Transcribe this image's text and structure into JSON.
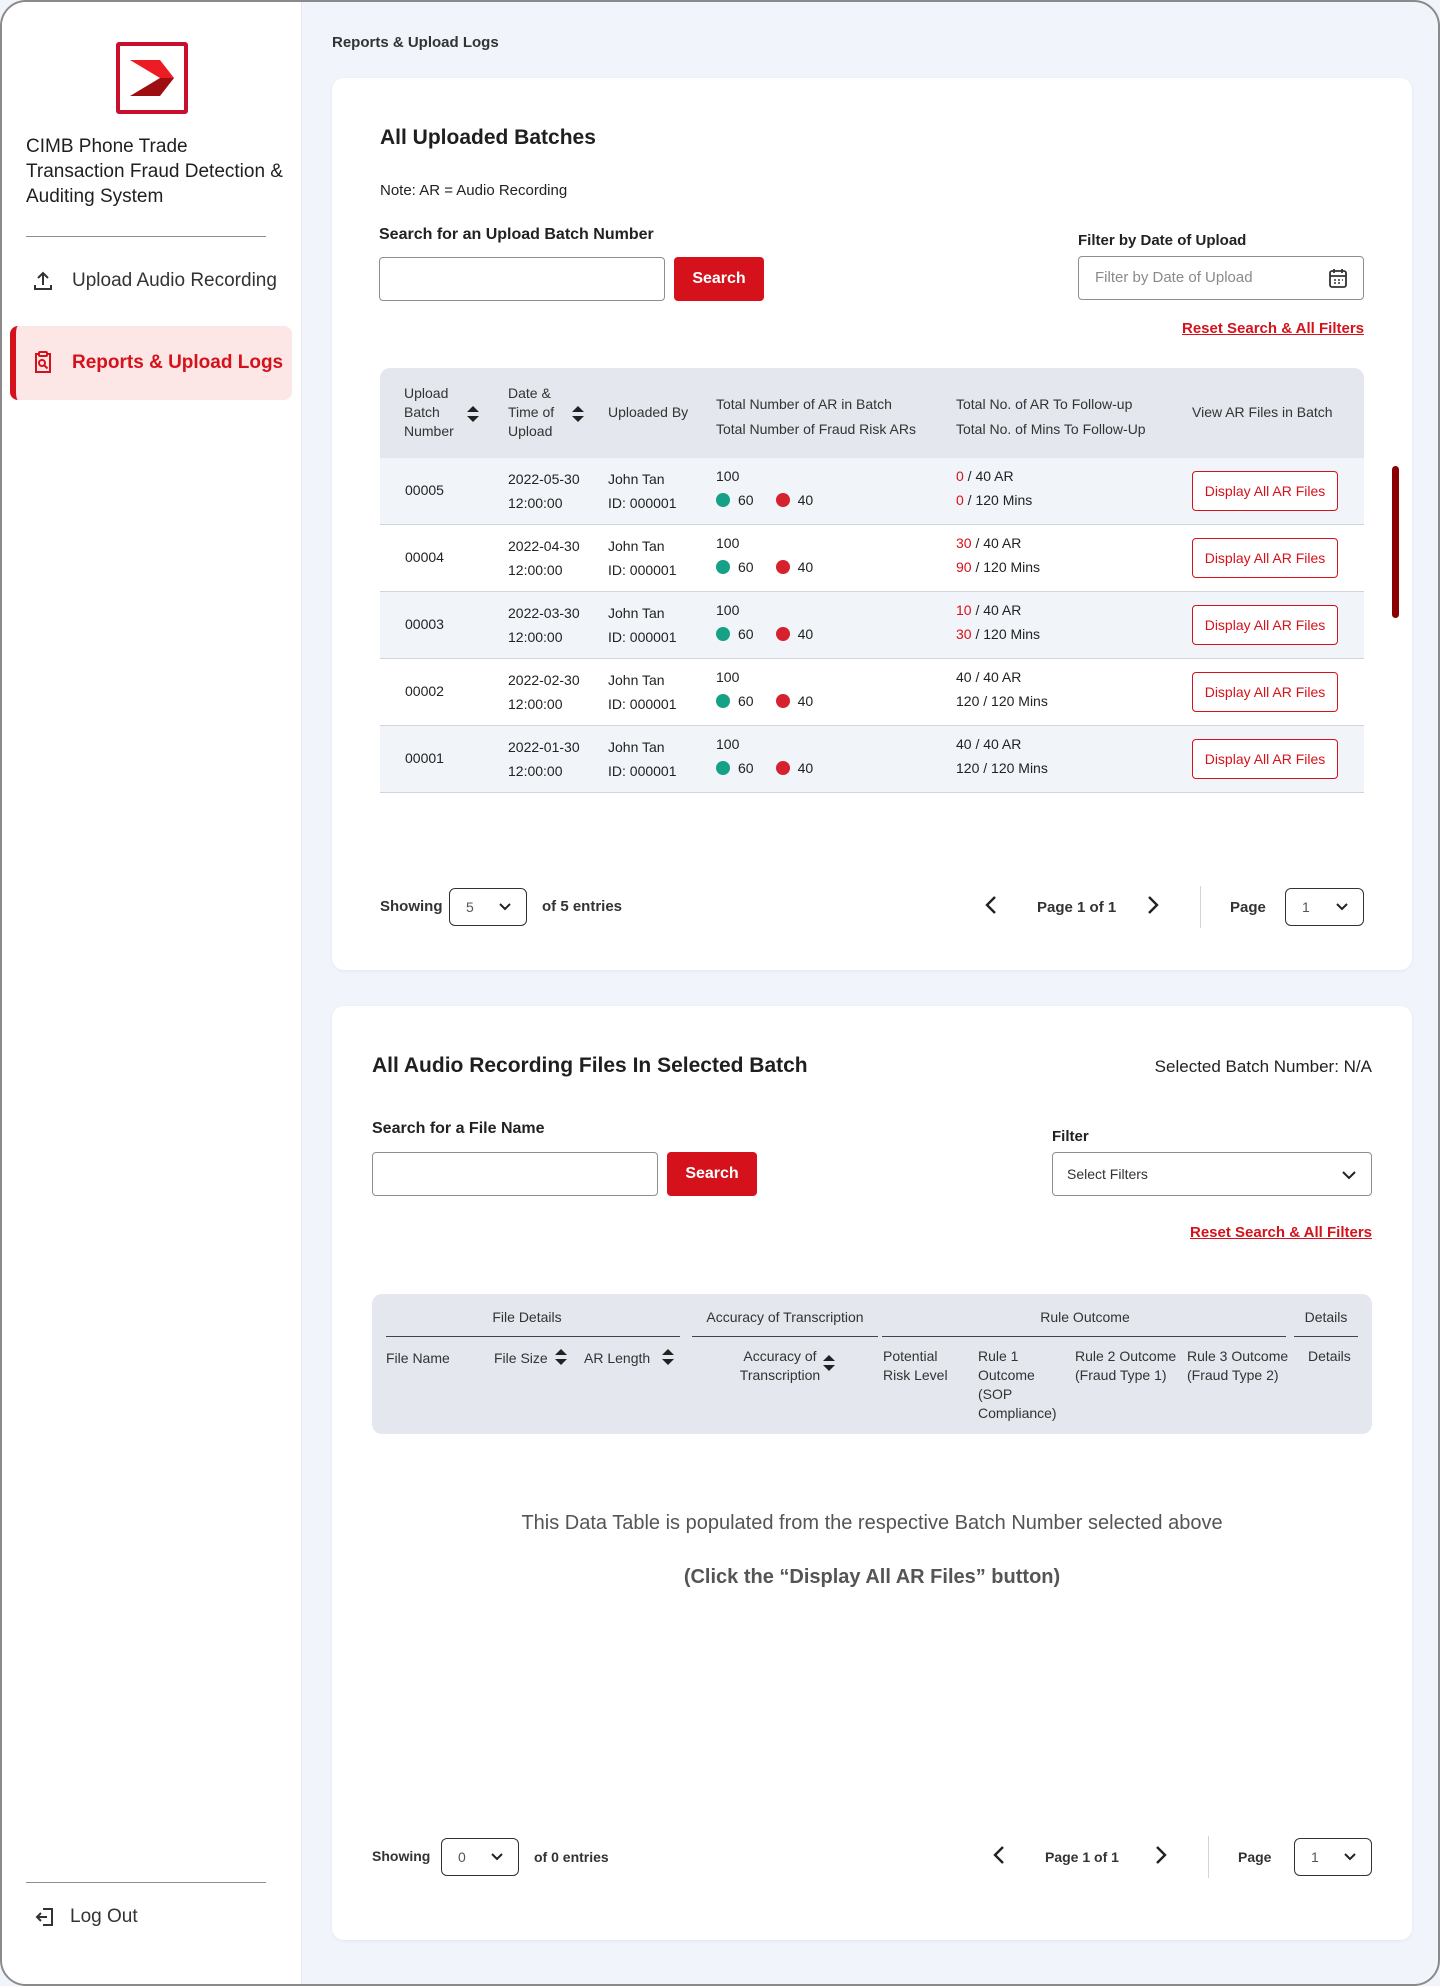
{
  "sidebar": {
    "app_title": "CIMB Phone Trade Transaction Fraud Detection & Auditing System",
    "nav": [
      {
        "label": "Upload Audio Recording",
        "icon": "upload-icon"
      },
      {
        "label": "Reports & Upload Logs",
        "icon": "report-search-icon",
        "active": true
      }
    ],
    "logout_label": "Log Out",
    "accent": "#d5121b"
  },
  "breadcrumb": "Reports & Upload Logs",
  "batches": {
    "title": "All Uploaded Batches",
    "note": "Note: AR = Audio Recording",
    "search_label": "Search for an Upload Batch Number",
    "search_button": "Search",
    "filter_label": "Filter by Date of Upload",
    "filter_placeholder": "Filter by Date of Upload",
    "reset_label": "Reset Search & All Filters",
    "columns": {
      "batch": "Upload Batch Number",
      "date": "Date & Time of Upload",
      "uploaded_by": "Uploaded By",
      "total_line1": "Total Number of AR in Batch",
      "total_line2": "Total Number of Fraud Risk ARs",
      "follow_line1": "Total No. of AR To Follow-up",
      "follow_line2": "Total No. of Mins To Follow-Up",
      "view": "View AR Files in Batch"
    },
    "rows": [
      {
        "batch": "00005",
        "date": "2022-05-30",
        "time": "12:00:00",
        "name": "John Tan",
        "id": "ID: 000001",
        "total": "100",
        "green": "60",
        "red": "40",
        "ar_done": "0",
        "ar_total": " / 40 AR",
        "min_done": "0",
        "min_total": " / 120 Mins",
        "highlight": true,
        "button": "Display All AR Files"
      },
      {
        "batch": "00004",
        "date": "2022-04-30",
        "time": "12:00:00",
        "name": "John Tan",
        "id": "ID: 000001",
        "total": "100",
        "green": "60",
        "red": "40",
        "ar_done": "30",
        "ar_total": " / 40 AR",
        "min_done": "90",
        "min_total": " / 120 Mins",
        "highlight": true,
        "button": "Display All AR Files"
      },
      {
        "batch": "00003",
        "date": "2022-03-30",
        "time": "12:00:00",
        "name": "John Tan",
        "id": "ID: 000001",
        "total": "100",
        "green": "60",
        "red": "40",
        "ar_done": "10",
        "ar_total": " / 40 AR",
        "min_done": "30",
        "min_total": " / 120 Mins",
        "highlight": true,
        "button": "Display All AR Files"
      },
      {
        "batch": "00002",
        "date": "2022-02-30",
        "time": "12:00:00",
        "name": "John Tan",
        "id": "ID: 000001",
        "total": "100",
        "green": "60",
        "red": "40",
        "ar_done": "40",
        "ar_total": " / 40 AR",
        "min_done": "120",
        "min_total": " / 120 Mins",
        "highlight": false,
        "button": "Display All AR Files"
      },
      {
        "batch": "00001",
        "date": "2022-01-30",
        "time": "12:00:00",
        "name": "John Tan",
        "id": "ID: 000001",
        "total": "100",
        "green": "60",
        "red": "40",
        "ar_done": "40",
        "ar_total": " / 40 AR",
        "min_done": "120",
        "min_total": " / 120 Mins",
        "highlight": false,
        "button": "Display All AR Files"
      }
    ],
    "pagination": {
      "showing": "Showing",
      "per_page": "5",
      "of_entries": "of 5 entries",
      "page_info": "Page 1 of 1",
      "page_label": "Page",
      "page_value": "1"
    }
  },
  "files": {
    "title": "All Audio Recording Files In Selected Batch",
    "selected_batch": "Selected Batch Number: N/A",
    "search_label": "Search for a File Name",
    "search_button": "Search",
    "filter_label": "Filter",
    "filter_placeholder": "Select Filters",
    "reset_label": "Reset Search & All Filters",
    "groups": {
      "file_details": "File Details",
      "accuracy": "Accuracy of Transcription",
      "rule_outcome": "Rule Outcome",
      "details": "Details"
    },
    "columns": {
      "file_name": "File Name",
      "file_size": "File Size",
      "ar_length": "AR Length",
      "accuracy": "Accuracy of Transcription",
      "risk": "Potential Risk Level",
      "rule1": "Rule 1 Outcome (SOP Compliance)",
      "rule2": "Rule 2 Outcome (Fraud Type 1)",
      "rule3": "Rule 3 Outcome (Fraud Type 2)",
      "details": "Details"
    },
    "empty_line1": "This Data Table is populated from the respective Batch Number selected above",
    "empty_line2": "(Click the “Display All AR Files” button)",
    "pagination": {
      "showing": "Showing",
      "per_page": "0",
      "of_entries": "of 0 entries",
      "page_info": "Page 1 of 1",
      "page_label": "Page",
      "page_value": "1"
    }
  }
}
